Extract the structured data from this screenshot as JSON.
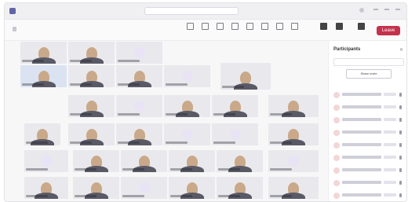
{
  "titlebar": {
    "search_placeholder": ""
  },
  "toolbar": {
    "timer": "",
    "leave_label": "Leave"
  },
  "panel": {
    "title": "Participants",
    "share_label": "Share invite",
    "in_meeting_label": ""
  }
}
